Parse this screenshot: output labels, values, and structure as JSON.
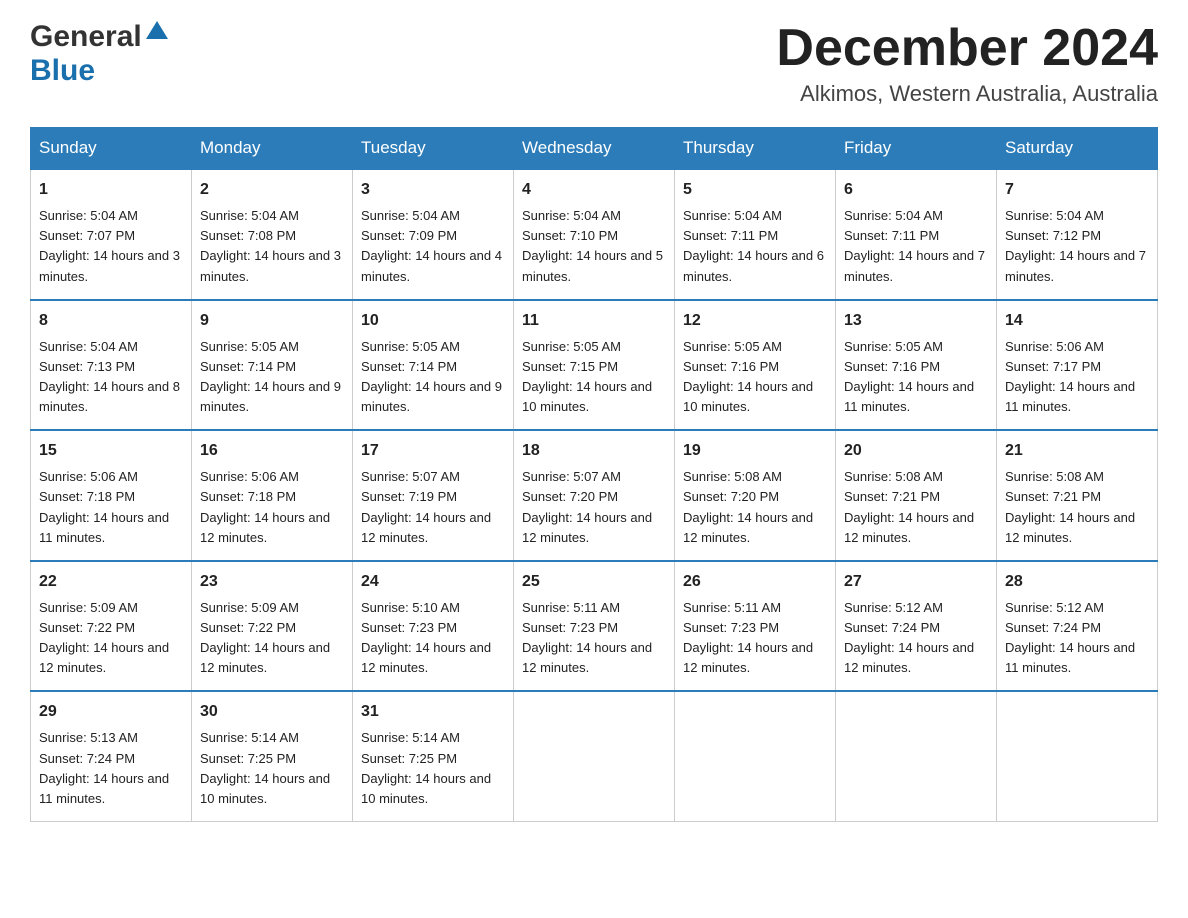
{
  "header": {
    "logo_general": "General",
    "logo_blue": "Blue",
    "month_title": "December 2024",
    "location": "Alkimos, Western Australia, Australia"
  },
  "days_of_week": [
    "Sunday",
    "Monday",
    "Tuesday",
    "Wednesday",
    "Thursday",
    "Friday",
    "Saturday"
  ],
  "weeks": [
    [
      {
        "day": "1",
        "sunrise": "Sunrise: 5:04 AM",
        "sunset": "Sunset: 7:07 PM",
        "daylight": "Daylight: 14 hours and 3 minutes."
      },
      {
        "day": "2",
        "sunrise": "Sunrise: 5:04 AM",
        "sunset": "Sunset: 7:08 PM",
        "daylight": "Daylight: 14 hours and 3 minutes."
      },
      {
        "day": "3",
        "sunrise": "Sunrise: 5:04 AM",
        "sunset": "Sunset: 7:09 PM",
        "daylight": "Daylight: 14 hours and 4 minutes."
      },
      {
        "day": "4",
        "sunrise": "Sunrise: 5:04 AM",
        "sunset": "Sunset: 7:10 PM",
        "daylight": "Daylight: 14 hours and 5 minutes."
      },
      {
        "day": "5",
        "sunrise": "Sunrise: 5:04 AM",
        "sunset": "Sunset: 7:11 PM",
        "daylight": "Daylight: 14 hours and 6 minutes."
      },
      {
        "day": "6",
        "sunrise": "Sunrise: 5:04 AM",
        "sunset": "Sunset: 7:11 PM",
        "daylight": "Daylight: 14 hours and 7 minutes."
      },
      {
        "day": "7",
        "sunrise": "Sunrise: 5:04 AM",
        "sunset": "Sunset: 7:12 PM",
        "daylight": "Daylight: 14 hours and 7 minutes."
      }
    ],
    [
      {
        "day": "8",
        "sunrise": "Sunrise: 5:04 AM",
        "sunset": "Sunset: 7:13 PM",
        "daylight": "Daylight: 14 hours and 8 minutes."
      },
      {
        "day": "9",
        "sunrise": "Sunrise: 5:05 AM",
        "sunset": "Sunset: 7:14 PM",
        "daylight": "Daylight: 14 hours and 9 minutes."
      },
      {
        "day": "10",
        "sunrise": "Sunrise: 5:05 AM",
        "sunset": "Sunset: 7:14 PM",
        "daylight": "Daylight: 14 hours and 9 minutes."
      },
      {
        "day": "11",
        "sunrise": "Sunrise: 5:05 AM",
        "sunset": "Sunset: 7:15 PM",
        "daylight": "Daylight: 14 hours and 10 minutes."
      },
      {
        "day": "12",
        "sunrise": "Sunrise: 5:05 AM",
        "sunset": "Sunset: 7:16 PM",
        "daylight": "Daylight: 14 hours and 10 minutes."
      },
      {
        "day": "13",
        "sunrise": "Sunrise: 5:05 AM",
        "sunset": "Sunset: 7:16 PM",
        "daylight": "Daylight: 14 hours and 11 minutes."
      },
      {
        "day": "14",
        "sunrise": "Sunrise: 5:06 AM",
        "sunset": "Sunset: 7:17 PM",
        "daylight": "Daylight: 14 hours and 11 minutes."
      }
    ],
    [
      {
        "day": "15",
        "sunrise": "Sunrise: 5:06 AM",
        "sunset": "Sunset: 7:18 PM",
        "daylight": "Daylight: 14 hours and 11 minutes."
      },
      {
        "day": "16",
        "sunrise": "Sunrise: 5:06 AM",
        "sunset": "Sunset: 7:18 PM",
        "daylight": "Daylight: 14 hours and 12 minutes."
      },
      {
        "day": "17",
        "sunrise": "Sunrise: 5:07 AM",
        "sunset": "Sunset: 7:19 PM",
        "daylight": "Daylight: 14 hours and 12 minutes."
      },
      {
        "day": "18",
        "sunrise": "Sunrise: 5:07 AM",
        "sunset": "Sunset: 7:20 PM",
        "daylight": "Daylight: 14 hours and 12 minutes."
      },
      {
        "day": "19",
        "sunrise": "Sunrise: 5:08 AM",
        "sunset": "Sunset: 7:20 PM",
        "daylight": "Daylight: 14 hours and 12 minutes."
      },
      {
        "day": "20",
        "sunrise": "Sunrise: 5:08 AM",
        "sunset": "Sunset: 7:21 PM",
        "daylight": "Daylight: 14 hours and 12 minutes."
      },
      {
        "day": "21",
        "sunrise": "Sunrise: 5:08 AM",
        "sunset": "Sunset: 7:21 PM",
        "daylight": "Daylight: 14 hours and 12 minutes."
      }
    ],
    [
      {
        "day": "22",
        "sunrise": "Sunrise: 5:09 AM",
        "sunset": "Sunset: 7:22 PM",
        "daylight": "Daylight: 14 hours and 12 minutes."
      },
      {
        "day": "23",
        "sunrise": "Sunrise: 5:09 AM",
        "sunset": "Sunset: 7:22 PM",
        "daylight": "Daylight: 14 hours and 12 minutes."
      },
      {
        "day": "24",
        "sunrise": "Sunrise: 5:10 AM",
        "sunset": "Sunset: 7:23 PM",
        "daylight": "Daylight: 14 hours and 12 minutes."
      },
      {
        "day": "25",
        "sunrise": "Sunrise: 5:11 AM",
        "sunset": "Sunset: 7:23 PM",
        "daylight": "Daylight: 14 hours and 12 minutes."
      },
      {
        "day": "26",
        "sunrise": "Sunrise: 5:11 AM",
        "sunset": "Sunset: 7:23 PM",
        "daylight": "Daylight: 14 hours and 12 minutes."
      },
      {
        "day": "27",
        "sunrise": "Sunrise: 5:12 AM",
        "sunset": "Sunset: 7:24 PM",
        "daylight": "Daylight: 14 hours and 12 minutes."
      },
      {
        "day": "28",
        "sunrise": "Sunrise: 5:12 AM",
        "sunset": "Sunset: 7:24 PM",
        "daylight": "Daylight: 14 hours and 11 minutes."
      }
    ],
    [
      {
        "day": "29",
        "sunrise": "Sunrise: 5:13 AM",
        "sunset": "Sunset: 7:24 PM",
        "daylight": "Daylight: 14 hours and 11 minutes."
      },
      {
        "day": "30",
        "sunrise": "Sunrise: 5:14 AM",
        "sunset": "Sunset: 7:25 PM",
        "daylight": "Daylight: 14 hours and 10 minutes."
      },
      {
        "day": "31",
        "sunrise": "Sunrise: 5:14 AM",
        "sunset": "Sunset: 7:25 PM",
        "daylight": "Daylight: 14 hours and 10 minutes."
      },
      null,
      null,
      null,
      null
    ]
  ]
}
